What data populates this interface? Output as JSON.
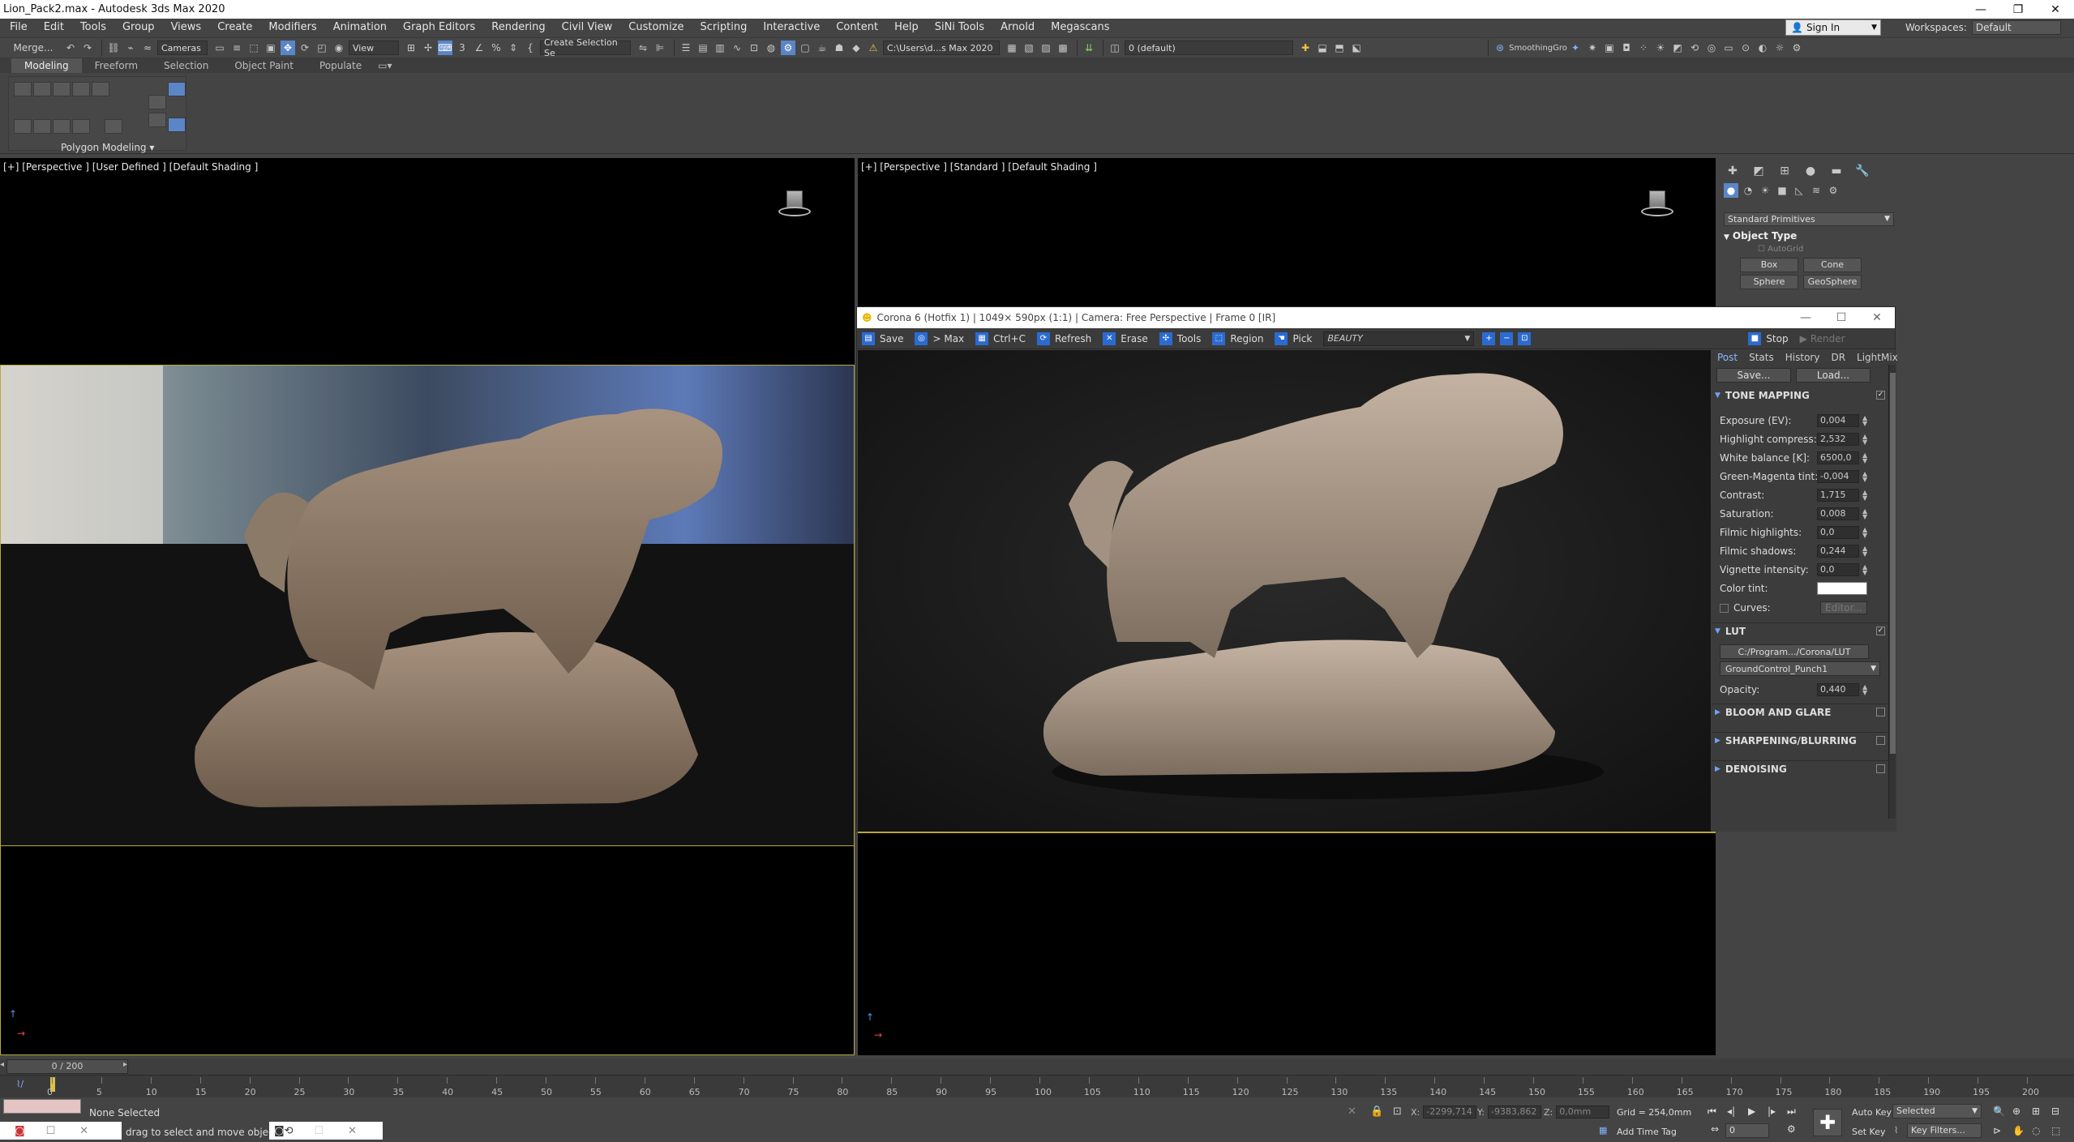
{
  "window": {
    "title": "Lion_Pack2.max - Autodesk 3ds Max 2020",
    "minimize": "—",
    "restore": "❐",
    "close": "✕"
  },
  "menu": [
    "File",
    "Edit",
    "Tools",
    "Group",
    "Views",
    "Create",
    "Modifiers",
    "Animation",
    "Graph Editors",
    "Rendering",
    "Civil View",
    "Customize",
    "Scripting",
    "Interactive",
    "Content",
    "Help",
    "SiNi Tools",
    "Arnold",
    "Megascans"
  ],
  "signin": {
    "label": "Sign In"
  },
  "workspaces": {
    "label": "Workspaces:",
    "value": "Default"
  },
  "toolbar": {
    "merge": "Merge...",
    "cameras": "Cameras",
    "view": "View",
    "create_selection": "Create Selection Se",
    "path": "C:\\Users\\d...s Max 2020",
    "layer": "0 (default)",
    "smoothing": "SmoothingGro"
  },
  "ribbon": {
    "tabs": [
      "Modeling",
      "Freeform",
      "Selection",
      "Object Paint",
      "Populate"
    ],
    "polygon_label": "Polygon Modeling"
  },
  "viewports": {
    "top_left": "[+] [Perspective ] [User Defined ] [Default Shading ]",
    "top_right": "[+] [Perspective ] [Standard ] [Default Shading ]"
  },
  "vfb": {
    "title": "Corona 6 (Hotfix 1) | 1049× 590px (1:1) | Camera: Free Perspective | Frame 0 [IR]",
    "tools": [
      "Save",
      "> Max",
      "Ctrl+C",
      "Refresh",
      "Erase",
      "Tools",
      "Region",
      "Pick"
    ],
    "pass": "BEAUTY",
    "stop": "Stop",
    "render": "Render",
    "side_tabs": [
      "Post",
      "Stats",
      "History",
      "DR",
      "LightMix"
    ],
    "save_btn": "Save...",
    "load_btn": "Load...",
    "tone_mapping": "TONE MAPPING",
    "params": [
      {
        "label": "Exposure (EV):",
        "value": "0,004"
      },
      {
        "label": "Highlight compress:",
        "value": "2,532"
      },
      {
        "label": "White balance [K]:",
        "value": "6500,0"
      },
      {
        "label": "Green-Magenta tint:",
        "value": "-0,004"
      },
      {
        "label": "Contrast:",
        "value": "1,715"
      },
      {
        "label": "Saturation:",
        "value": "0,008"
      },
      {
        "label": "Filmic highlights:",
        "value": "0,0"
      },
      {
        "label": "Filmic shadows:",
        "value": "0,244"
      },
      {
        "label": "Vignette intensity:",
        "value": "0,0"
      }
    ],
    "color_tint": "Color tint:",
    "curves": "Curves:",
    "editor": "Editor...",
    "lut": "LUT",
    "lut_path": "C:/Program.../Corona/LUT",
    "lut_file": "GroundControl_Punch1",
    "opacity_label": "Opacity:",
    "opacity_value": "0,440",
    "bloom": "BLOOM AND GLARE",
    "sharpen": "SHARPENING/BLURRING",
    "denoise": "DENOISING"
  },
  "command_panel": {
    "dropdown": "Standard Primitives",
    "rollout": "Object Type",
    "autogrid": "AutoGrid",
    "buttons": [
      "Box",
      "Cone",
      "Sphere",
      "GeoSphere"
    ]
  },
  "timeline": {
    "frame": "0 / 200",
    "ticks": [
      "0",
      "5",
      "10",
      "15",
      "20",
      "25",
      "30",
      "35",
      "40",
      "45",
      "50",
      "55",
      "60",
      "65",
      "70",
      "75",
      "80",
      "85",
      "90",
      "95",
      "100",
      "105",
      "110",
      "115",
      "120",
      "125",
      "130",
      "135",
      "140",
      "145",
      "150",
      "155",
      "160",
      "165",
      "170",
      "175",
      "180",
      "185",
      "190",
      "195",
      "200"
    ]
  },
  "status": {
    "selection": "None Selected",
    "prompt": "drag to select and move objects",
    "x_label": "X:",
    "x_value": "-2299,714",
    "y_label": "Y:",
    "y_value": "-9383,862",
    "z_label": "Z:",
    "z_value": "0,0mm",
    "grid": "Grid = 254,0mm",
    "add_time_tag": "Add Time Tag",
    "auto_key": "Auto Key",
    "set_key": "Set Key",
    "selected": "Selected",
    "key_filters": "Key Filters...",
    "frame_value": "0"
  },
  "colors": {
    "viewport_active_border": "#b9a83a",
    "accent_blue": "#2b6bd1"
  }
}
